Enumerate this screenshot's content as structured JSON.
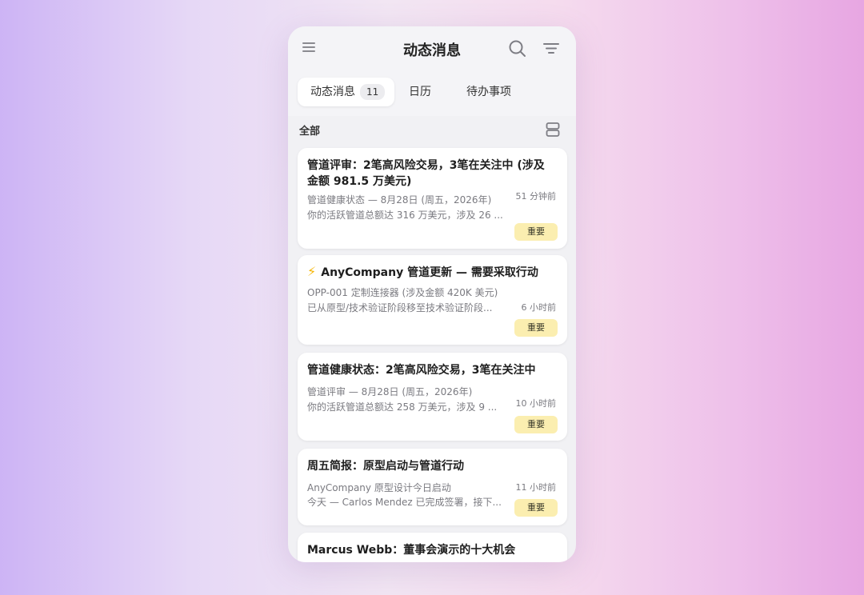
{
  "header": {
    "title": "动态消息"
  },
  "icons": {
    "menu": "menu-icon",
    "search": "search-icon",
    "filter": "filter-icon",
    "view_toggle": "view-toggle-icon",
    "bolt": "lightning-icon"
  },
  "tabs": [
    {
      "label": "动态消息",
      "badge": "11",
      "active": true
    },
    {
      "label": "日历",
      "active": false
    },
    {
      "label": "待办事项",
      "active": false
    }
  ],
  "section": {
    "label": "全部"
  },
  "colors": {
    "tag_bg": "#fbeeb0",
    "bolt": "#f5b400"
  },
  "cards": [
    {
      "title": "管道评审：2笔高风险交易，3笔在关注中 (涉及金额 981.5 万美元)",
      "line1": "管道健康状态 — 8月28日 (周五，2026年)",
      "line2": "你的活跃管道总额达 316 万美元，涉及 26 ...",
      "time": "51 分钟前",
      "tag": "重要"
    },
    {
      "title": "AnyCompany 管道更新 — 需要采取行动",
      "line1": "OPP-001 定制连接器 (涉及金额 420K 美元)",
      "line2": "已从原型/技术验证阶段移至技术验证阶段...",
      "time": "6 小时前",
      "tag": "重要"
    },
    {
      "title": "管道健康状态：2笔高风险交易，3笔在关注中",
      "line1": "管道评审 — 8月28日 (周五，2026年)",
      "line2": "你的活跃管道总额达 258 万美元，涉及 9 ...",
      "time": "10 小时前",
      "tag": "重要"
    },
    {
      "title": "周五简报：原型启动与管道行动",
      "line1": "AnyCompany 原型设计今日启动",
      "line2": "今天 — Carlos Mendez 已完成签署，接下...",
      "time": "11 小时前",
      "tag": "重要"
    },
    {
      "title": "Marcus Webb：董事会演示的十大机会"
    }
  ]
}
